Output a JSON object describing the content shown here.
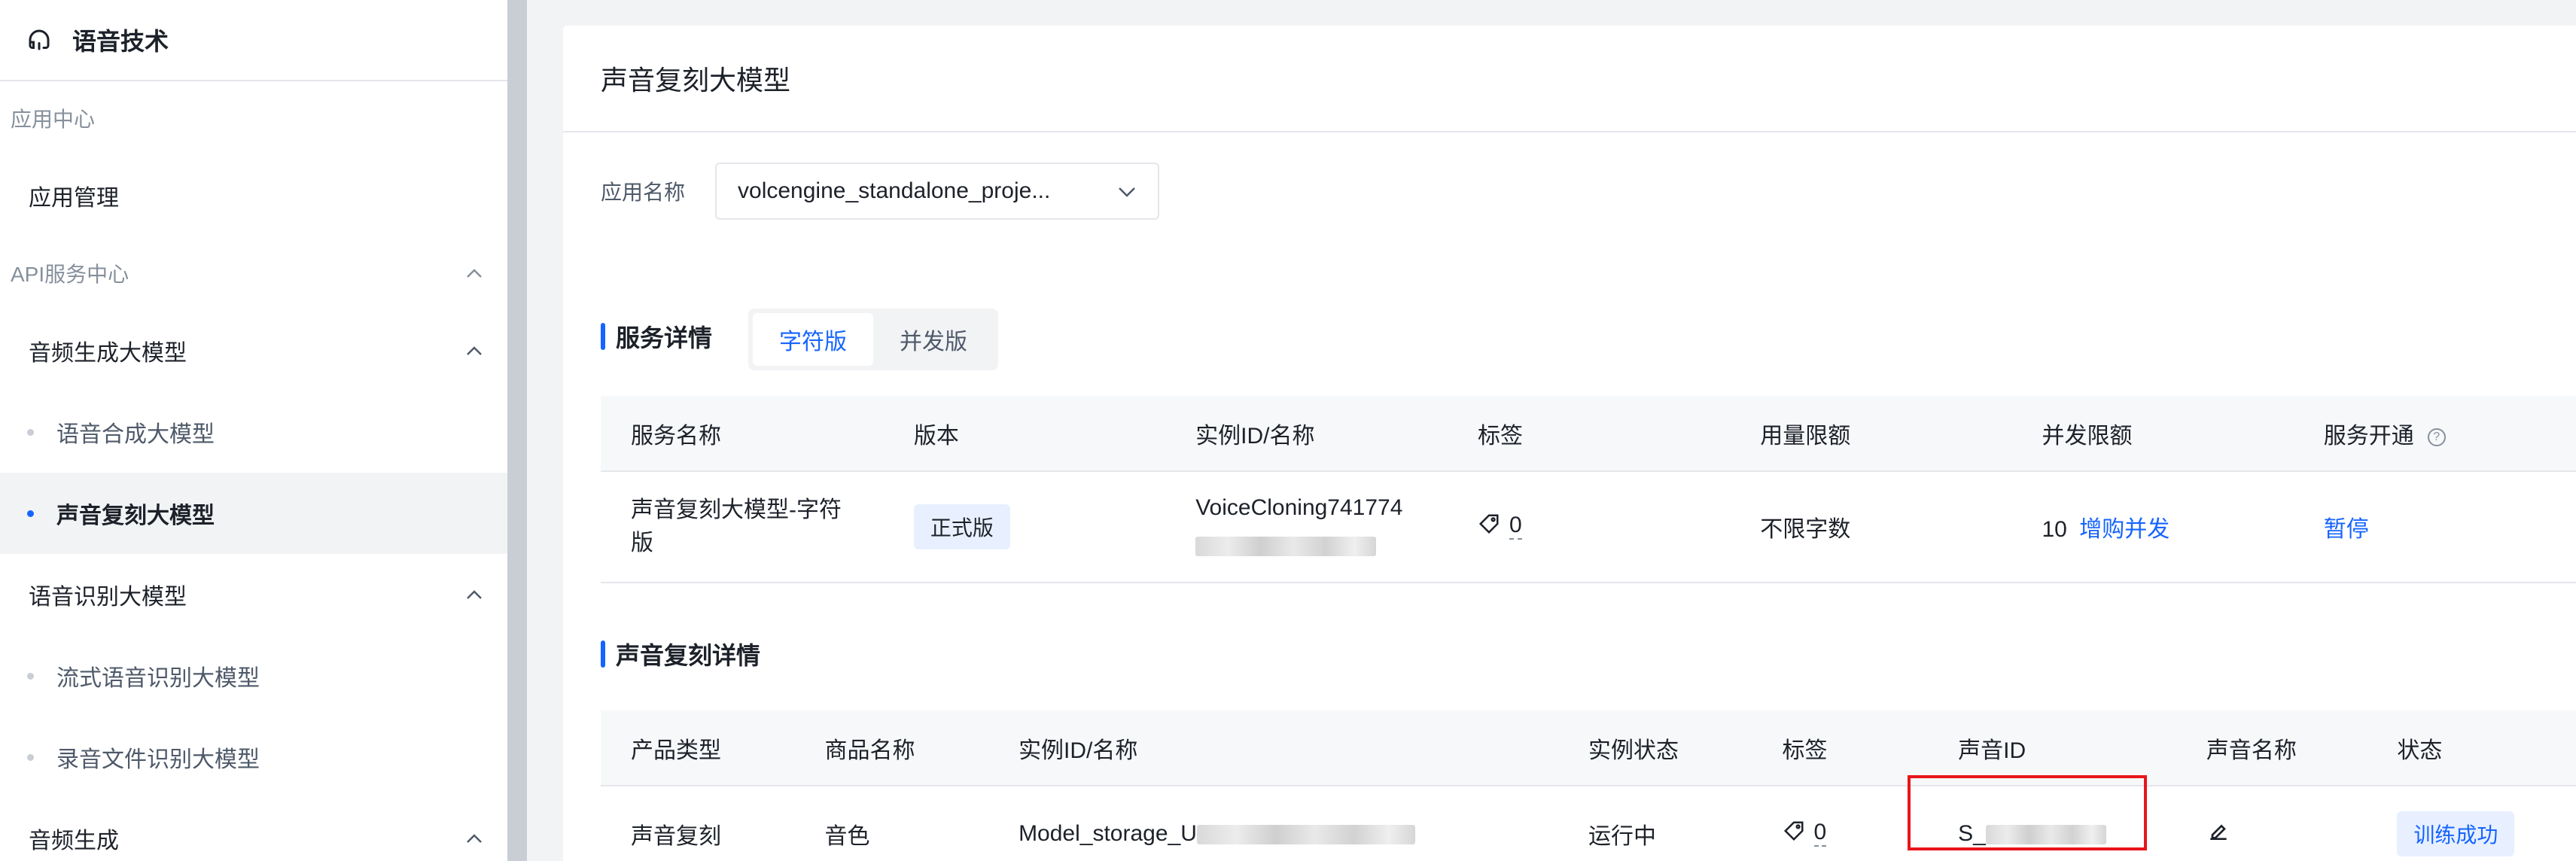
{
  "sidebar": {
    "title": "语音技术",
    "app_center_label": "应用中心",
    "app_manage": "应用管理",
    "api_center_label": "API服务中心",
    "audio_gen_large": "音频生成大模型",
    "tts_large": "语音合成大模型",
    "voice_clone_large": "声音复刻大模型",
    "asr_large": "语音识别大模型",
    "stream_asr_large": "流式语音识别大模型",
    "file_asr_large": "录音文件识别大模型",
    "audio_gen": "音频生成"
  },
  "main": {
    "page_title": "声音复刻大模型",
    "app_name_label": "应用名称",
    "app_name_value": "volcengine_standalone_proje...",
    "service_section_title": "服务详情",
    "segments": [
      "字符版",
      "并发版"
    ],
    "service_table": {
      "headers": [
        "服务名称",
        "版本",
        "实例ID/名称",
        "标签",
        "用量限额",
        "并发限额",
        "服务开通"
      ],
      "row": {
        "service_name": "声音复刻大模型-字符版",
        "version": "正式版",
        "instance_id": "VoiceCloning741774",
        "tag_count": "0",
        "usage_limit": "不限字数",
        "concurrency": "10",
        "buy_concurrency": "增购并发",
        "action": "暂停"
      }
    },
    "clone_section_title": "声音复刻详情",
    "clone_table": {
      "headers": [
        "产品类型",
        "商品名称",
        "实例ID/名称",
        "实例状态",
        "标签",
        "声音ID",
        "声音名称",
        "状态"
      ],
      "row": {
        "product_type": "声音复刻",
        "product_name": "音色",
        "instance_prefix": "Model_storage_U",
        "instance_state": "运行中",
        "tag_count": "0",
        "voice_id_prefix": "S_",
        "status": "训练成功"
      }
    }
  },
  "colors": {
    "accent": "#1664ff",
    "highlight_box": "#e8151b",
    "sidebar_divider": "#c9cdd4"
  }
}
